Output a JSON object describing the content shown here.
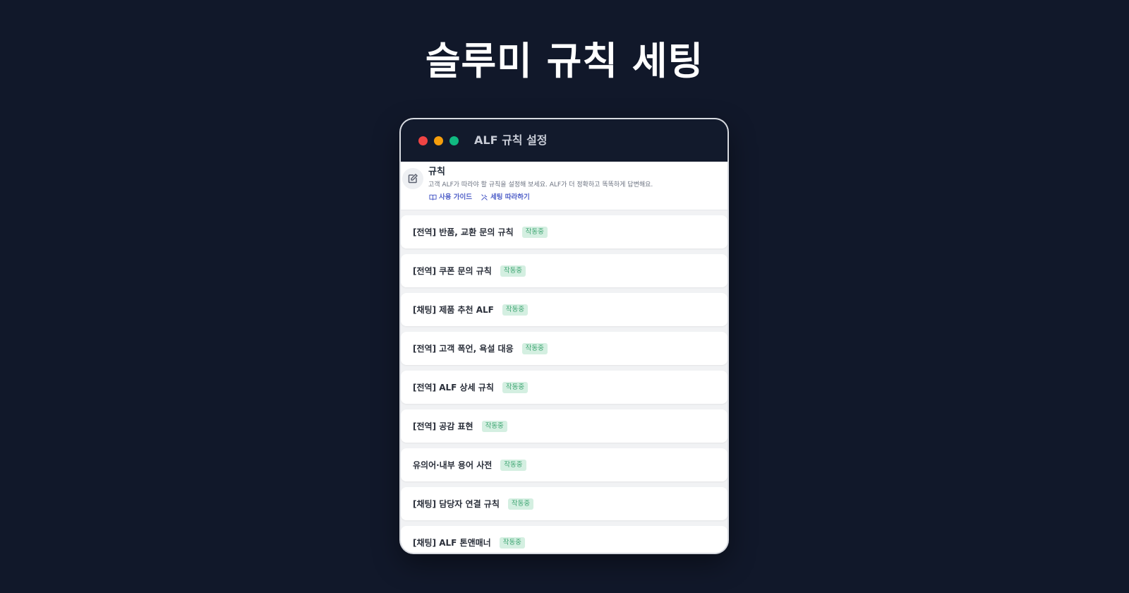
{
  "page": {
    "title": "슬루미 규칙 세팅"
  },
  "window": {
    "title": "ALF 규칙 설정",
    "controls": {
      "close_color": "#ef4444",
      "minimize_color": "#f59e0b",
      "maximize_color": "#10b981"
    }
  },
  "rules_header": {
    "icon": "edit-icon",
    "heading": "규칙",
    "description": "고객 ALF가 따라야 할 규칙을 설정해 보세요. ALF가 더 정확하고 똑똑하게 답변해요.",
    "links": [
      {
        "icon": "book-icon",
        "label": "사용 가이드"
      },
      {
        "icon": "tools-icon",
        "label": "세팅 따라하기"
      }
    ]
  },
  "rules": [
    {
      "name": "[전역] 반품, 교환 문의 규칙",
      "status": "작동중"
    },
    {
      "name": "[전역] 쿠폰 문의 규칙",
      "status": "작동중"
    },
    {
      "name": "[채팅] 제품 추천 ALF",
      "status": "작동중"
    },
    {
      "name": "[전역] 고객 폭언, 욕설 대응",
      "status": "작동중"
    },
    {
      "name": "[전역] ALF 상세 규칙",
      "status": "작동중"
    },
    {
      "name": "[전역] 공감 표현",
      "status": "작동중"
    },
    {
      "name": "유의어·내부 용어 사전",
      "status": "작동중"
    },
    {
      "name": "[채팅] 담당자 연결 규칙",
      "status": "작동중"
    },
    {
      "name": "[채팅] ALF 톤앤매너",
      "status": "작동중"
    }
  ]
}
